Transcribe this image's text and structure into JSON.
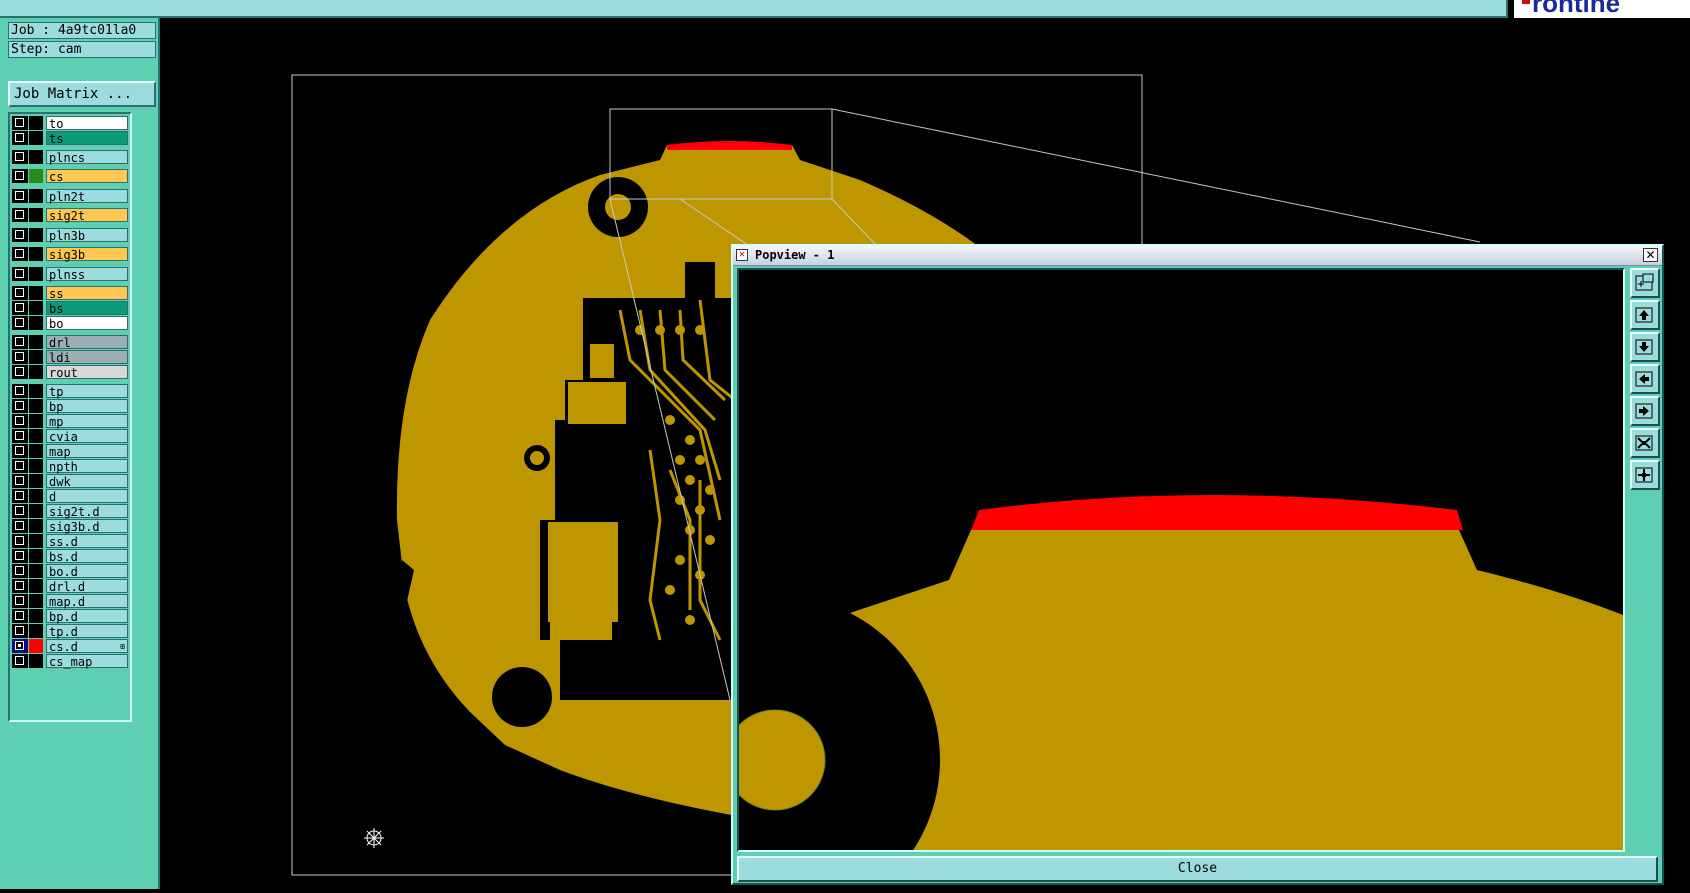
{
  "job": {
    "label": "Job : 4a9tc01la0",
    "step": "Step: cam"
  },
  "job_matrix_button": "Job Matrix ...",
  "brand": {
    "fragment": "rontine"
  },
  "layers": [
    {
      "name": "to",
      "style": "white",
      "swatch": ""
    },
    {
      "name": "ts",
      "style": "green",
      "swatch": ""
    },
    {
      "name": "plncs",
      "style": "cyan",
      "swatch": ""
    },
    {
      "name": "cs",
      "style": "yellow",
      "swatch": "#2a8a1a"
    },
    {
      "name": "pln2t",
      "style": "cyan",
      "swatch": ""
    },
    {
      "name": "sig2t",
      "style": "yellow",
      "swatch": ""
    },
    {
      "name": "pln3b",
      "style": "cyan",
      "swatch": ""
    },
    {
      "name": "sig3b",
      "style": "yellow",
      "swatch": ""
    },
    {
      "name": "plnss",
      "style": "cyan",
      "swatch": ""
    },
    {
      "name": "ss",
      "style": "yellow",
      "swatch": ""
    },
    {
      "name": "bs",
      "style": "green",
      "swatch": ""
    },
    {
      "name": "bo",
      "style": "white",
      "swatch": ""
    },
    {
      "name": "drl",
      "style": "grey",
      "swatch": ""
    },
    {
      "name": "ldi",
      "style": "grey",
      "swatch": ""
    },
    {
      "name": "rout",
      "style": "lgrey",
      "swatch": ""
    },
    {
      "name": "tp",
      "style": "cyan",
      "swatch": ""
    },
    {
      "name": "bp",
      "style": "cyan",
      "swatch": ""
    },
    {
      "name": "mp",
      "style": "cyan",
      "swatch": ""
    },
    {
      "name": "cvia",
      "style": "cyan",
      "swatch": ""
    },
    {
      "name": "map",
      "style": "cyan",
      "swatch": ""
    },
    {
      "name": "npth",
      "style": "cyan",
      "swatch": ""
    },
    {
      "name": "dwk",
      "style": "cyan",
      "swatch": ""
    },
    {
      "name": "d",
      "style": "cyan",
      "swatch": ""
    },
    {
      "name": "sig2t.d",
      "style": "cyan",
      "swatch": ""
    },
    {
      "name": "sig3b.d",
      "style": "cyan",
      "swatch": ""
    },
    {
      "name": "ss.d",
      "style": "cyan",
      "swatch": ""
    },
    {
      "name": "bs.d",
      "style": "cyan",
      "swatch": ""
    },
    {
      "name": "bo.d",
      "style": "cyan",
      "swatch": ""
    },
    {
      "name": "drl.d",
      "style": "cyan",
      "swatch": ""
    },
    {
      "name": "map.d",
      "style": "cyan",
      "swatch": ""
    },
    {
      "name": "bp.d",
      "style": "cyan",
      "swatch": ""
    },
    {
      "name": "tp.d",
      "style": "cyan",
      "swatch": ""
    },
    {
      "name": "cs.d",
      "style": "cyan",
      "swatch": "#ff0000",
      "active": true
    },
    {
      "name": "cs_map",
      "style": "cyan",
      "swatch": ""
    }
  ],
  "popup": {
    "title": "Popview - 1",
    "close_x": "✕",
    "close_label": "Close",
    "tools": [
      "zoom-fit-icon",
      "pan-up-icon",
      "pan-down-icon",
      "pan-left-icon",
      "pan-right-icon",
      "zoom-in-icon",
      "zoom-out-icon"
    ]
  },
  "colors": {
    "board": "#be9600",
    "highlight": "#ff0000",
    "panel": "#5ecfb1",
    "field": "#9cdcdc"
  }
}
